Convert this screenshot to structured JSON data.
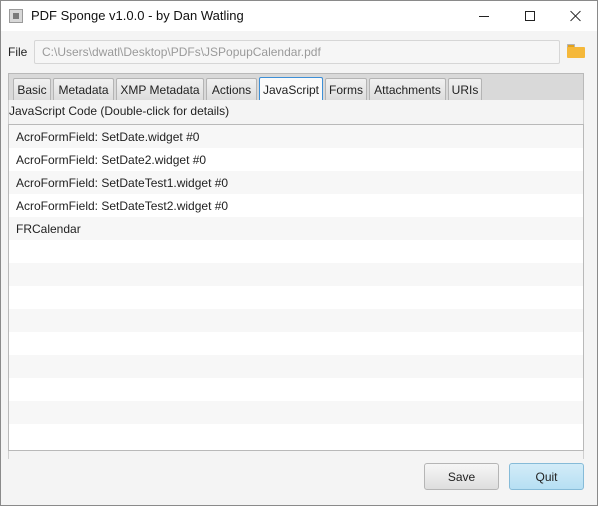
{
  "window": {
    "title": "PDF Sponge v1.0.0 - by Dan Watling"
  },
  "file": {
    "label": "File",
    "path": "C:\\Users\\dwatl\\Desktop\\PDFs\\JSPopupCalendar.pdf"
  },
  "tabs": [
    {
      "label": "Basic",
      "active": false
    },
    {
      "label": "Metadata",
      "active": false
    },
    {
      "label": "XMP Metadata",
      "active": false
    },
    {
      "label": "Actions",
      "active": false
    },
    {
      "label": "JavaScript",
      "active": true
    },
    {
      "label": "Forms",
      "active": false
    },
    {
      "label": "Attachments",
      "active": false
    },
    {
      "label": "URIs",
      "active": false
    }
  ],
  "javascript": {
    "section_label": "JavaScript Code (Double-click for details)",
    "items": [
      "AcroFormField: SetDate.widget #0",
      "AcroFormField: SetDate2.widget #0",
      "AcroFormField: SetDateTest1.widget #0",
      "AcroFormField: SetDateTest2.widget #0",
      "FRCalendar"
    ]
  },
  "buttons": {
    "save_label": "Save",
    "quit_label": "Quit"
  },
  "icons": {
    "app": "app-icon",
    "folder": "folder-icon"
  },
  "colors": {
    "active_tab_border": "#3d8fd6",
    "quit_button": "#b6dff3",
    "folder": "#f5b83a"
  }
}
